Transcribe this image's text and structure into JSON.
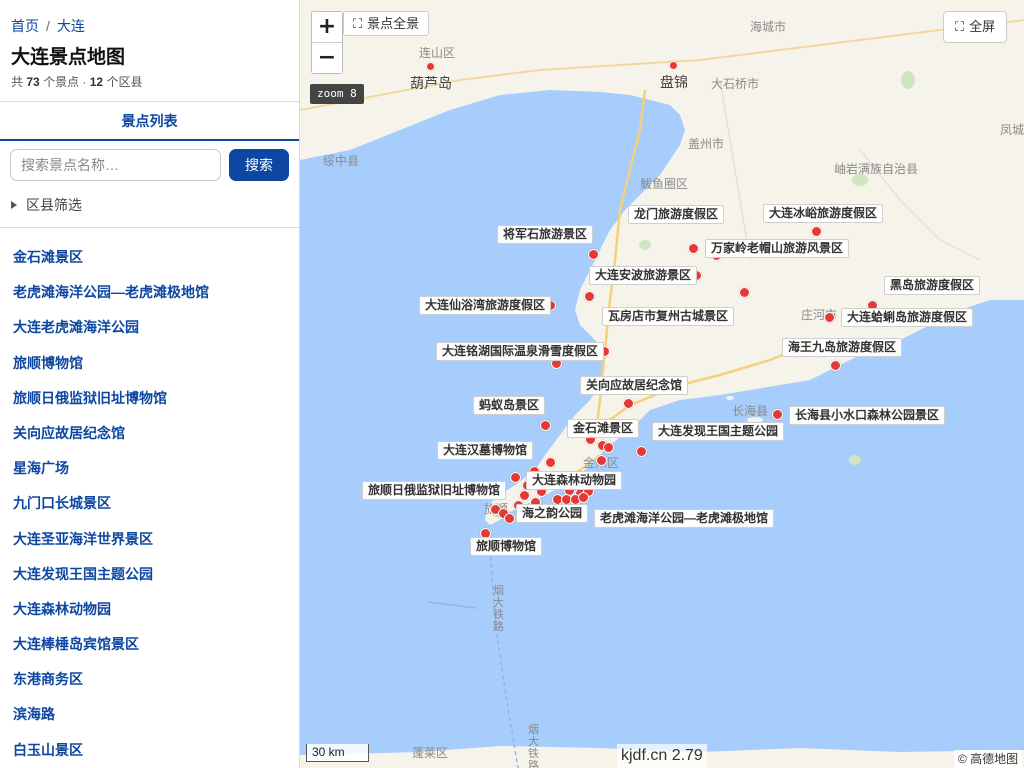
{
  "breadcrumb": {
    "home": "首页",
    "separator": "/",
    "current": "大连"
  },
  "page_title": "大连景点地图",
  "summary": {
    "prefix": "共",
    "spot_count": "73",
    "spot_unit": "个景点 ·",
    "district_count": "12",
    "district_unit": "个区县"
  },
  "tab": {
    "label": "景点列表"
  },
  "search": {
    "placeholder": "搜索景点名称…",
    "button_label": "搜索"
  },
  "filter": {
    "label": "区县筛选"
  },
  "list_items": [
    "金石滩景区",
    "老虎滩海洋公园—老虎滩极地馆",
    "大连老虎滩海洋公园",
    "旅顺博物馆",
    "旅顺日俄监狱旧址博物馆",
    "关向应故居纪念馆",
    "星海广场",
    "九门口长城景区",
    "大连圣亚海洋世界景区",
    "大连发现王国主题公园",
    "大连森林动物园",
    "大连棒棰岛宾馆景区",
    "东港商务区",
    "滨海路",
    "白玉山景区"
  ],
  "map": {
    "zoom_in": "+",
    "zoom_out": "−",
    "overview_icon": "fullscreen-icon",
    "overview_label": "景点全景",
    "fullscreen_label": "全屏",
    "zoom_badge": "zoom 8",
    "scale_label": "30 km",
    "watermark": "kjdf.cn 2.79",
    "attribution": "© 高德地图",
    "place_labels": {
      "lianshan": "连山区",
      "huludao": "葫芦岛",
      "panjin": "盘锦",
      "dashiqiao": "大石桥市",
      "haicheng": "海城市",
      "gaizhou": "盖州市",
      "suizhong": "绥中县",
      "xiuyan": "岫岩满族自治县",
      "bayuquan": "鲅鱼圈区",
      "fengcheng": "凤城",
      "zhuanghe": "庄河市",
      "changhai": "长海县",
      "jinzhou": "金州区",
      "lvshun": "旅顺",
      "penglai": "蓬莱区",
      "railway": "烟大铁路",
      "railway2": "烟大铁路"
    },
    "poi_labels": [
      "龙门旅游度假区",
      "大连冰峪旅游度假区",
      "将军石旅游景区",
      "万家岭老帽山旅游风景区",
      "大连安波旅游景区",
      "黑岛旅游度假区",
      "大连仙浴湾旅游度假区",
      "瓦房店市复州古城景区",
      "大连蛤蜊岛旅游度假区",
      "大连铭湖国际温泉滑雪度假区",
      "海王九岛旅游度假区",
      "关向应故居纪念馆",
      "蚂蚁岛景区",
      "长海县小水口森林公园景区",
      "金石滩景区",
      "大连发现王国主题公园",
      "大连汉墓博物馆",
      "大连森林动物园",
      "旅顺日俄监狱旧址博物馆",
      "海之韵公园",
      "老虎滩海洋公园—老虎滩极地馆",
      "旅顺博物馆"
    ]
  }
}
